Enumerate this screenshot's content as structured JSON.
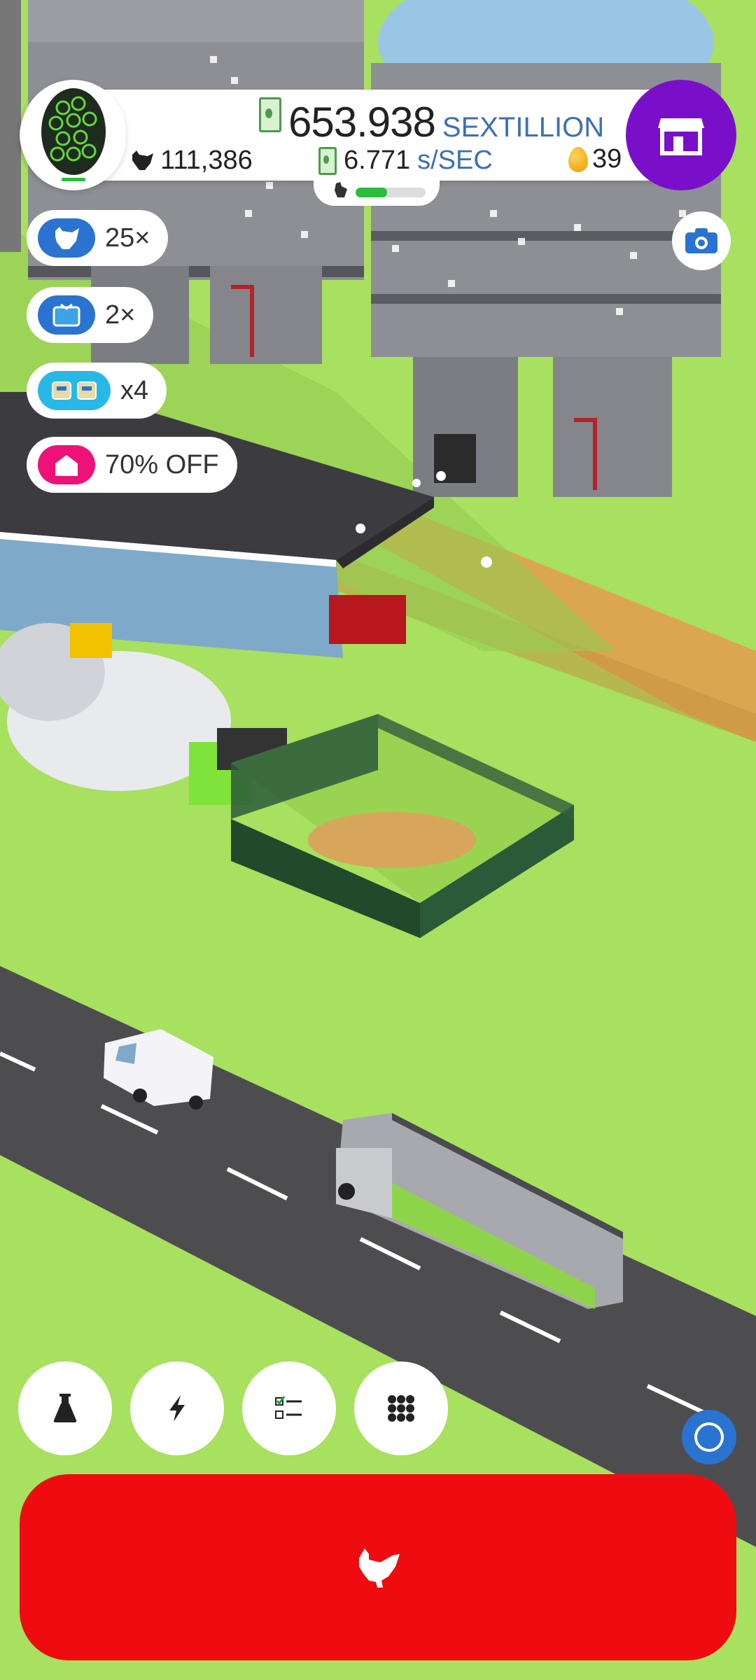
{
  "hud": {
    "money_value": "653.938",
    "money_unit": "SEXTILLION",
    "chicken_count": "111,386",
    "rate_value": "6.771",
    "rate_unit": "s/SEC",
    "golden_eggs": "39",
    "progress_fraction": 0.45
  },
  "boosts": [
    {
      "icon": "chicken-icon",
      "label": "25×",
      "color": "#2a73d1"
    },
    {
      "icon": "tv-icon",
      "label": "2×",
      "color": "#2a73d1"
    },
    {
      "icon": "drone-icon",
      "label": "x4",
      "color": "#29b8e6"
    },
    {
      "icon": "house-icon",
      "label": "70% OFF",
      "color": "#ee1177"
    }
  ],
  "colors": {
    "hatch_button": "#ee0c10",
    "shop_button": "#7a0fc9",
    "ground": "#a8e05f"
  }
}
